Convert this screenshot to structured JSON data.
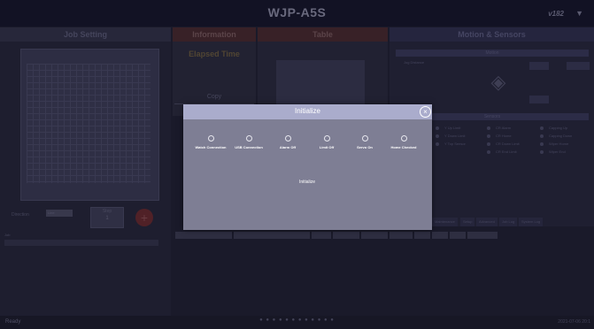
{
  "app": {
    "title": "WJP-A5S",
    "version": "v182",
    "version_arrow": "▼"
  },
  "job": {
    "title": "Job Setting",
    "direction_label": "Direction",
    "direction_value": "Line",
    "step_label": "Step",
    "step_value": "1",
    "sub_label": "Job"
  },
  "information": {
    "title": "Information",
    "elapsed_label": "Elapsed Time",
    "copy_label": "Copy"
  },
  "table": {
    "title": "Table"
  },
  "motion": {
    "title": "Motion & Sensors",
    "motion_sub": "Motion",
    "jog_label": "Jog  Distance",
    "sensors_sub": "Sensors",
    "sensors": [
      "Y Up Limit",
      "Y Down Limit",
      "Y Top Sensor",
      "CR Alarm",
      "CR Home",
      "CR Down Limit",
      "CR End Limit",
      "Capping Up",
      "Capping Down",
      "Wiper Home",
      "Wiper End"
    ],
    "tabs": [
      "Maintenance",
      "Setup",
      "Advanced",
      "Job Log",
      "System Log"
    ]
  },
  "status": {
    "ready": "Ready",
    "dots": "● ● ●   ● ● ●   ● ● ●   ● ● ●",
    "time": "2021-07-06 20:1"
  },
  "dialog": {
    "title": "Initialize",
    "close_icon": "×",
    "steps": [
      "Watch Connection",
      "USB Connection",
      "Alarm Off",
      "Limit Off",
      "Servo On",
      "Home Checked"
    ],
    "button": "Initialize"
  }
}
